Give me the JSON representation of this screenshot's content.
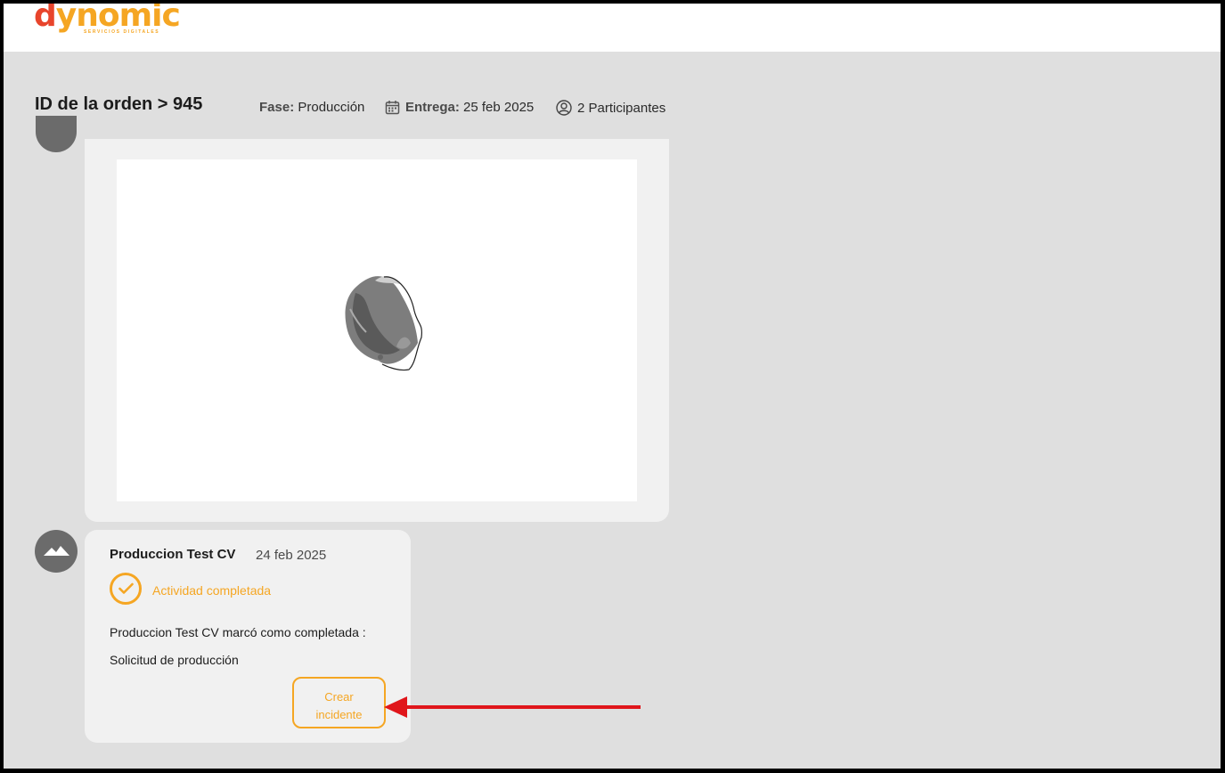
{
  "brand": {
    "logo_text": "dynomic",
    "tagline": "SERVICIOS DIGITALES",
    "accent": "#f5a623",
    "accent2": "#e8452c"
  },
  "header": {
    "order_title": "ID de la orden > 945",
    "fase_label": "Fase:",
    "fase_value": "Producción",
    "entrega_label": "Entrega:",
    "entrega_value": "25 feb 2025",
    "participants": "2 Participantes",
    "icons": [
      "calendar-icon",
      "user-circle-icon"
    ]
  },
  "timeline": {
    "image_card": {
      "content": "3d-model-render"
    },
    "activity": {
      "avatar_icon": "mountain-icon",
      "author": "Produccion Test CV",
      "date": "24 feb 2025",
      "status": "Actividad completada",
      "line1": "Produccion Test CV marcó como completada :",
      "line2": "Solicitud de producción",
      "button_line1": "Crear",
      "button_line2": "incidente"
    }
  },
  "annotation": {
    "arrow_color": "#e0161b",
    "icon": "red-arrow-icon"
  }
}
